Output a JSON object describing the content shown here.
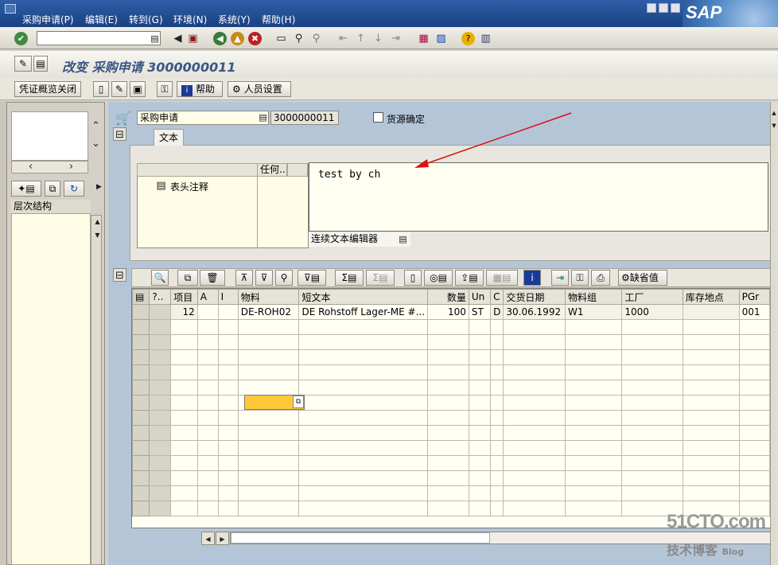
{
  "menu": {
    "items": [
      "采购申请(P)",
      "编辑(E)",
      "转到(G)",
      "环境(N)",
      "系统(Y)",
      "帮助(H)"
    ]
  },
  "title": "改变 采购申请 3000000011",
  "app_toolbar": {
    "doc_overview_close": "凭证概览关闭",
    "help": "帮助",
    "personal_settings": "人员设置"
  },
  "navigator": {
    "tree_header": "层次结构"
  },
  "header": {
    "doc_type": "采购申请",
    "doc_number": "3000000011",
    "source_determination": "货源确定"
  },
  "texts_tab": {
    "tab_label": "文本",
    "col_any": "任何...",
    "header_note": "表头注释",
    "text_content": "test by ch",
    "editor_link": "连续文本编辑器"
  },
  "items_toolbar": {
    "default_values": "缺省值"
  },
  "items_table": {
    "columns": [
      "?..",
      "项目",
      "A",
      "I",
      "物料",
      "短文本",
      "数量",
      "Un",
      "C",
      "交货日期",
      "物料组",
      "工厂",
      "库存地点",
      "PGr"
    ],
    "rows": [
      [
        "",
        "12",
        "",
        "",
        "DE-ROH02",
        "DE Rohstoff Lager-ME #...",
        "100",
        "ST",
        "D",
        "30.06.1992",
        "W1",
        "1000",
        "",
        "001"
      ]
    ]
  },
  "watermark": {
    "line1": "51CTO.com",
    "line2": "技术博客",
    "line3": "Blog"
  }
}
